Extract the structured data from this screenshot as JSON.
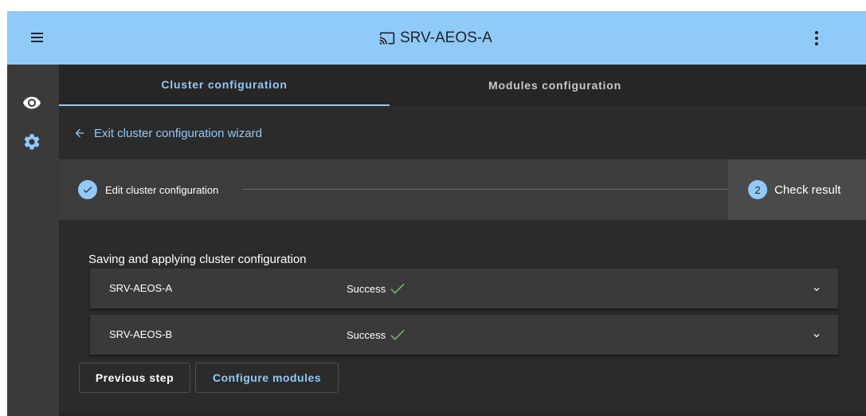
{
  "app": {
    "title": "SRV-AEOS-A"
  },
  "icons": {
    "menu": "hamburger-menu-icon",
    "cast": "cast-icon",
    "more": "more-vertical-icon",
    "eye": "eye-icon",
    "gear": "gear-icon",
    "back": "arrow-left-icon",
    "check": "check-icon",
    "chevron": "chevron-down-icon"
  },
  "colors": {
    "accent": "#90caf9",
    "success": "#66bb6a",
    "background": "#2b2b2b"
  },
  "tabs": [
    {
      "label": "Cluster configuration",
      "active": true
    },
    {
      "label": "Modules configuration",
      "active": false
    }
  ],
  "wizard": {
    "exit_label": "Exit cluster configuration wizard"
  },
  "stepper": {
    "steps": [
      {
        "label": "Edit cluster configuration",
        "state": "completed"
      },
      {
        "number": "2",
        "label": "Check result",
        "state": "active"
      }
    ]
  },
  "results": {
    "title": "Saving and applying cluster configuration",
    "items": [
      {
        "name": "SRV-AEOS-A",
        "status": "Success"
      },
      {
        "name": "SRV-AEOS-B",
        "status": "Success"
      }
    ]
  },
  "actions": {
    "previous": "Previous step",
    "next": "Configure modules"
  }
}
